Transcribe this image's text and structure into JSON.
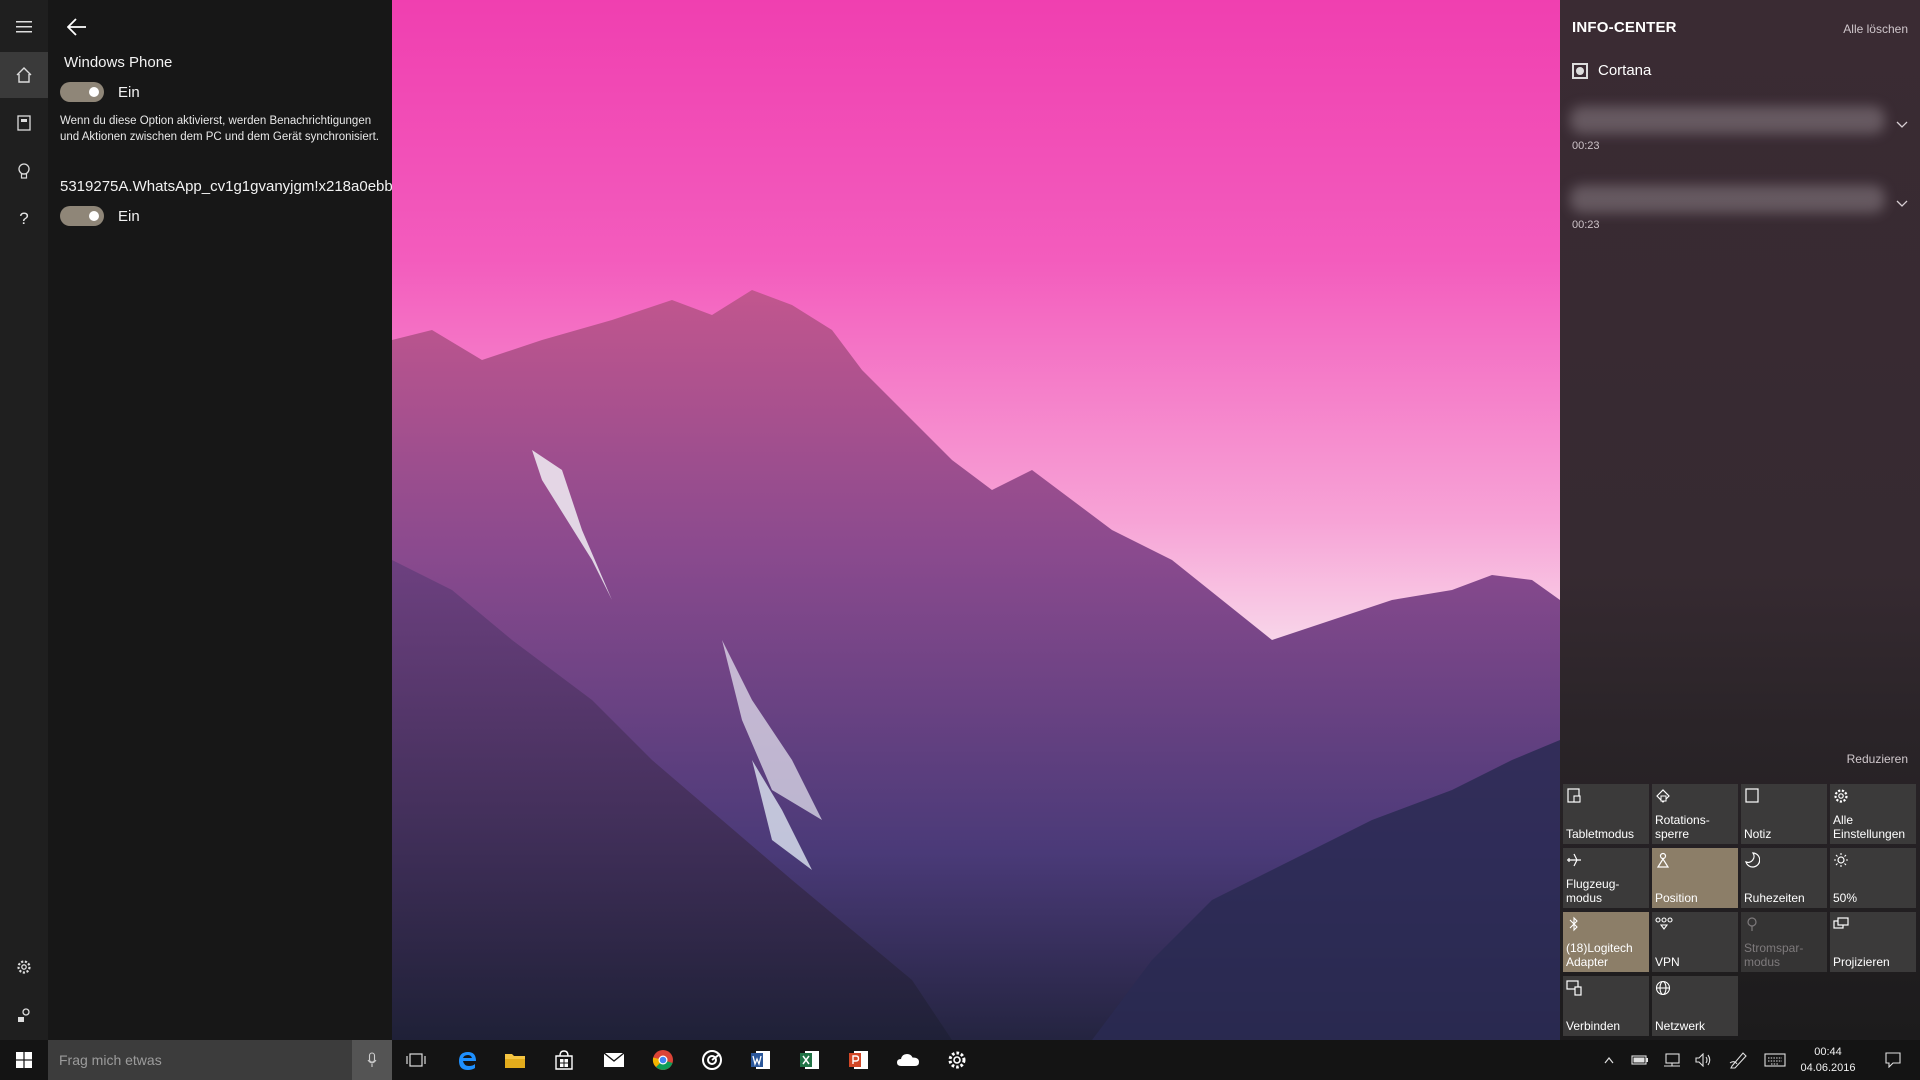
{
  "cortana_panel": {
    "rail_icons": [
      "menu-icon",
      "home-icon",
      "notebook-icon",
      "lightbulb-icon",
      "help-icon",
      "settings-icon",
      "feedback-icon"
    ],
    "rail_help_glyph": "?",
    "setting1_title": "Windows Phone",
    "setting1_state": "Ein",
    "setting1_description": "Wenn du diese Option aktivierst, werden Benachrichtigungen und Aktionen zwischen dem PC und dem Gerät synchronisiert.",
    "setting2_title": "5319275A.WhatsApp_cv1g1gvanyjgm!x218a0ebb",
    "setting2_state": "Ein"
  },
  "action_center": {
    "title": "INFO-CENTER",
    "clear_all": "Alle löschen",
    "app_group": "Cortana",
    "notifications": [
      {
        "time": "00:23"
      },
      {
        "time": "00:23"
      }
    ],
    "collapse_label": "Reduzieren",
    "tiles": [
      {
        "label": "Tabletmodus",
        "icon": "tablet-mode-icon",
        "state": "off"
      },
      {
        "label": "Rotations-\nsperre",
        "icon": "rotation-lock-icon",
        "state": "off"
      },
      {
        "label": "Notiz",
        "icon": "note-icon",
        "state": "off"
      },
      {
        "label": "Alle\nEinstellungen",
        "icon": "settings-icon",
        "state": "off"
      },
      {
        "label": "Flugzeug-\nmodus",
        "icon": "airplane-icon",
        "state": "off"
      },
      {
        "label": "Position",
        "icon": "location-icon",
        "state": "on"
      },
      {
        "label": "Ruhezeiten",
        "icon": "moon-icon",
        "state": "off"
      },
      {
        "label": "50%",
        "icon": "brightness-icon",
        "state": "off"
      },
      {
        "label": "(18)Logitech\nAdapter",
        "icon": "bluetooth-icon",
        "state": "on"
      },
      {
        "label": "VPN",
        "icon": "vpn-icon",
        "state": "off"
      },
      {
        "label": "Stromspar-\nmodus",
        "icon": "battery-saver-icon",
        "state": "disabled"
      },
      {
        "label": "Projizieren",
        "icon": "project-icon",
        "state": "off"
      },
      {
        "label": "Verbinden",
        "icon": "connect-icon",
        "state": "off"
      },
      {
        "label": "Netzwerk",
        "icon": "network-icon",
        "state": "off"
      }
    ]
  },
  "taskbar": {
    "search_placeholder": "Frag mich etwas",
    "pinned_apps": [
      "task-view-icon",
      "edge-icon",
      "file-explorer-icon",
      "store-icon",
      "mail-icon",
      "chrome-icon",
      "groove-music-icon",
      "word-icon",
      "excel-icon",
      "powerpoint-icon",
      "onedrive-icon",
      "settings-icon"
    ],
    "tray_icons": [
      "show-hidden-icons-icon",
      "battery-icon",
      "network-icon",
      "volume-icon",
      "pen-icon",
      "keyboard-icon"
    ],
    "time": "00:44",
    "date": "04.06.2016",
    "notification_icon": "action-center-icon"
  },
  "colors": {
    "accent_active_tile": "#8c7e68",
    "tile_default": "#3b3a3a",
    "toggle_on": "#8f8678",
    "taskbar": "#141414"
  }
}
